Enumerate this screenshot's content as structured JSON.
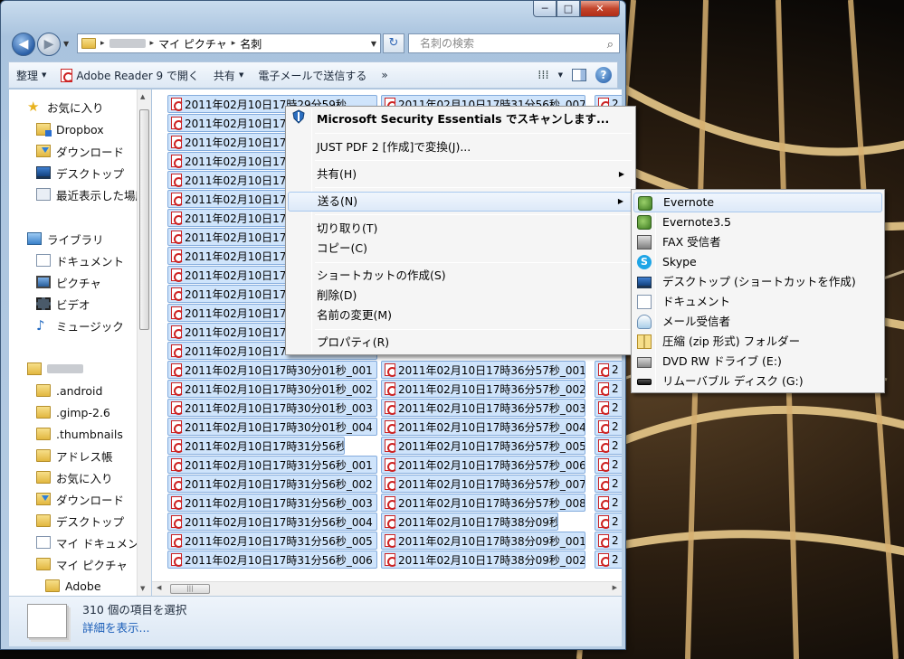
{
  "window": {
    "caption_buttons": {
      "minimize": "─",
      "maximize": "□",
      "close": "✕"
    }
  },
  "navbar": {
    "back_icon": "back-arrow-icon",
    "back_glyph": "◀",
    "forward_glyph": "▶",
    "breadcrumb": [
      "マイ ピクチャ",
      "名刺"
    ],
    "search_placeholder": "名刺の検索",
    "refresh_glyph": "↻",
    "search_glyph": "⌕",
    "dropdown_glyph": "▼",
    "crumb_sep": "▸"
  },
  "toolbar": {
    "organize": "整理",
    "open_with": "Adobe Reader 9 で開く",
    "share": "共有",
    "email": "電子メールで送信する",
    "more": "»",
    "dd": "▼",
    "view_glyph": "⁞⁞⁞",
    "help": "?"
  },
  "navpane": {
    "favorites_header": "お気に入り",
    "favorites": [
      "Dropbox",
      "ダウンロード",
      "デスクトップ",
      "最近表示した場所"
    ],
    "library_header": "ライブラリ",
    "libraries": [
      "ドキュメント",
      "ピクチャ",
      "ビデオ",
      "ミュージック"
    ],
    "user_items": [
      ".android",
      ".gimp-2.6",
      ".thumbnails",
      "アドレス帳",
      "お気に入り",
      "ダウンロード",
      "デスクトップ",
      "マイ ドキュメン",
      "マイ ピクチャ",
      "Adobe"
    ],
    "star_glyph": "★",
    "note_glyph": "♪",
    "scroll_up": "▲",
    "scroll_down": "▼"
  },
  "files": {
    "col1": [
      "2011年02月10日17時29分59秒",
      "2011年02月10日17",
      "2011年02月10日17",
      "2011年02月10日17",
      "2011年02月10日17",
      "2011年02月10日17",
      "2011年02月10日17",
      "2011年02月10日17",
      "2011年02月10日17",
      "2011年02月10日17",
      "2011年02月10日17",
      "2011年02月10日17",
      "2011年02月10日17",
      "2011年02月10日17",
      "2011年02月10日17時30分01秒_001",
      "2011年02月10日17時30分01秒_002",
      "2011年02月10日17時30分01秒_003",
      "2011年02月10日17時30分01秒_004",
      "2011年02月10日17時31分56秒",
      "2011年02月10日17時31分56秒_001",
      "2011年02月10日17時31分56秒_002",
      "2011年02月10日17時31分56秒_003",
      "2011年02月10日17時31分56秒_004",
      "2011年02月10日17時31分56秒_005",
      "2011年02月10日17時31分56秒_006"
    ],
    "col2_top": "2011年02月10日17時31分56秒_007",
    "col2": [
      "2011年02月10日17時36分57秒_001",
      "2011年02月10日17時36分57秒_002",
      "2011年02月10日17時36分57秒_003",
      "2011年02月10日17時36分57秒_004",
      "2011年02月10日17時36分57秒_005",
      "2011年02月10日17時36分57秒_006",
      "2011年02月10日17時36分57秒_007",
      "2011年02月10日17時36分57秒_008",
      "2011年02月10日17時38分09秒",
      "2011年02月10日17時38分09秒_001",
      "2011年02月10日17時38分09秒_002"
    ],
    "col3_prefix": "2",
    "hscroll_grip": "|||",
    "hscroll_left": "◀",
    "hscroll_right": "▶"
  },
  "details": {
    "count_text": "310 個の項目を選択",
    "link_text": "詳細を表示..."
  },
  "context_menu": {
    "items": [
      {
        "label": "Microsoft Security Essentials でスキャンします...",
        "bold": true
      },
      {
        "label": "JUST PDF 2 [作成]で変換(J)..."
      },
      {
        "label": "共有(H)",
        "submenu": true
      },
      {
        "label": "送る(N)",
        "submenu": true,
        "highlighted": true
      },
      {
        "label": "切り取り(T)"
      },
      {
        "label": "コピー(C)"
      },
      {
        "label": "ショートカットの作成(S)"
      },
      {
        "label": "削除(D)"
      },
      {
        "label": "名前の変更(M)"
      },
      {
        "label": "プロパティ(R)"
      }
    ],
    "arrow_glyph": "▶"
  },
  "send_to_menu": {
    "items": [
      {
        "label": "Evernote",
        "icon": "evernote-icon",
        "highlighted": true
      },
      {
        "label": "Evernote3.5",
        "icon": "evernote-icon"
      },
      {
        "label": "FAX 受信者",
        "icon": "fax-icon"
      },
      {
        "label": "Skype",
        "icon": "skype-icon"
      },
      {
        "label": "デスクトップ (ショートカットを作成)",
        "icon": "desktop-icon"
      },
      {
        "label": "ドキュメント",
        "icon": "document-icon"
      },
      {
        "label": "メール受信者",
        "icon": "mail-icon"
      },
      {
        "label": "圧縮 (zip 形式) フォルダー",
        "icon": "zip-folder-icon"
      },
      {
        "label": "DVD RW ドライブ (E:)",
        "icon": "dvd-drive-icon"
      },
      {
        "label": "リムーバブル ディスク (G:)",
        "icon": "removable-disk-icon"
      }
    ],
    "skype_glyph": "S"
  },
  "colors": {
    "selection": "#cfe4fb",
    "selection_border": "#84acdd",
    "menu_bg": "#f5f5f5",
    "link": "#1b5eb8"
  }
}
